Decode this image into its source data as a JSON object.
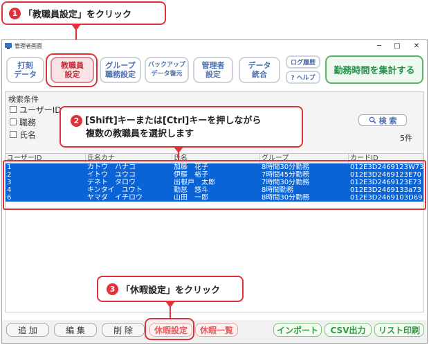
{
  "callouts": {
    "step1": {
      "num": "1",
      "text": "「教職員設定」をクリック"
    },
    "step2": {
      "num": "2",
      "line1": "[Shift]キーまたは[Ctrl]キーを押しながら",
      "line2": "複数の教職員を選択します"
    },
    "step3": {
      "num": "3",
      "text": "「休暇設定」をクリック"
    }
  },
  "window": {
    "title": "管理者画面",
    "controls": {
      "minimize": "─",
      "maximize": "□",
      "close": "✕"
    }
  },
  "toolbar": {
    "buttons": [
      {
        "line1": "打刻",
        "line2": "データ"
      },
      {
        "line1": "教職員",
        "line2": "設定"
      },
      {
        "line1": "グループ",
        "line2": "職務設定"
      },
      {
        "line1": "バックアップ",
        "line2": "データ復元"
      },
      {
        "line1": "管理者",
        "line2": "設定"
      },
      {
        "line1": "データ",
        "line2": "統合"
      }
    ],
    "log_history": "ログ履歴",
    "help": "? ヘルプ",
    "aggregate": "勤務時間を集計する"
  },
  "search": {
    "title": "検索条件",
    "options": [
      "ユーザーID",
      "職務",
      "氏名"
    ],
    "button": "検 索",
    "count": "5件"
  },
  "table": {
    "columns": [
      "ユーザーID",
      "氏名カナ",
      "氏名",
      "グループ",
      "カードID"
    ],
    "rows": [
      [
        "1",
        "カトウ　ハナコ",
        "加藤　花子",
        "8時間30分勤務",
        "012E3D2469123W73"
      ],
      [
        "2",
        "イトウ　ユウコ",
        "伊藤　裕子",
        "7時間45分勤務",
        "012E3D2469123E70"
      ],
      [
        "3",
        "デネト　タロウ",
        "出根戸　太郎",
        "7時間30分勤務",
        "012E3D2469123E73"
      ],
      [
        "4",
        "キンタイ　ユウト",
        "勤怠　悠斗",
        "8時間勤務",
        "012E3D2469133a73"
      ],
      [
        "6",
        "ヤマダ　イチロウ",
        "山田　一郎",
        "8時間30分勤務",
        "012E3D2469103D69"
      ]
    ]
  },
  "bottom": {
    "add": "追 加",
    "edit": "編 集",
    "delete": "削 除",
    "leave_settings": "休暇設定",
    "leave_list": "休暇一覧",
    "import": "インポート",
    "csv": "CSV出力",
    "print": "リスト印刷"
  }
}
